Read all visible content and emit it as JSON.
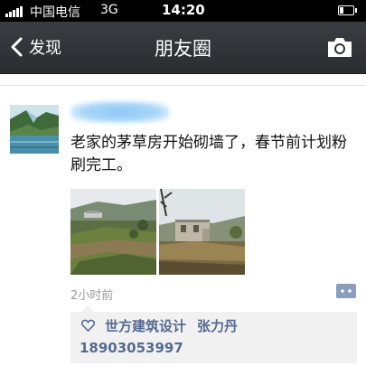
{
  "status_bar": {
    "carrier": "中国电信",
    "network": "3G",
    "time": "14:20"
  },
  "nav": {
    "back_label": "发现",
    "title": "朋友圈",
    "camera_icon": "camera-icon"
  },
  "post": {
    "author_name": "",
    "text": "老家的茅草房开始砌墙了，春节前计划粉刷完工。",
    "timestamp": "2小时前",
    "photos": [
      "landscape-photo",
      "house-construction-photo"
    ],
    "likes": {
      "company": "世方建筑设计",
      "person": "张力丹",
      "phone": "18903053997"
    }
  },
  "colors": {
    "nav_bg": "#2f3135",
    "link_blue": "#566a91",
    "likes_bg": "#f1f1f1",
    "timestamp_gray": "#9a9a9a"
  }
}
